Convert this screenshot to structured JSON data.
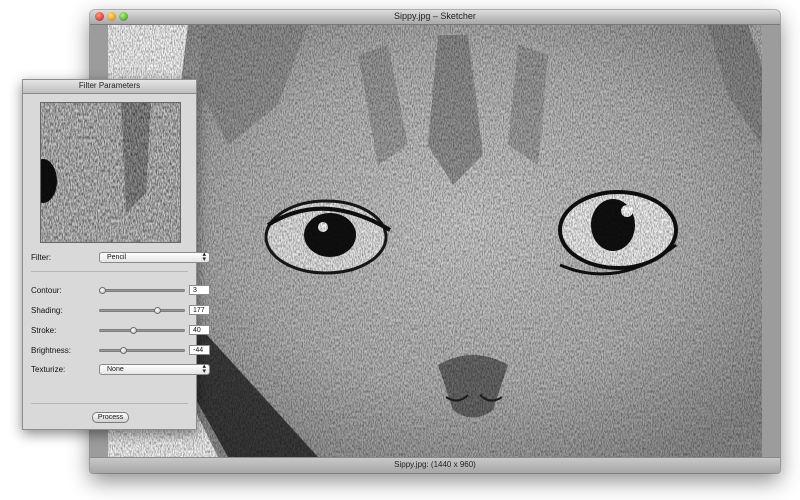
{
  "window": {
    "title": "Sippy.jpg – Sketcher",
    "status": "Sippy.jpg: (1440 x 960)"
  },
  "panel": {
    "title": "Filter Parameters",
    "filter": {
      "label": "Filter:",
      "value": "Pencil"
    },
    "sliders": [
      {
        "label": "Contour:",
        "value": "3",
        "fraction": 0.03
      },
      {
        "label": "Shading:",
        "value": "177",
        "fraction": 0.69
      },
      {
        "label": "Stroke:",
        "value": "40",
        "fraction": 0.4
      },
      {
        "label": "Brightness:",
        "value": "-44",
        "fraction": 0.28
      }
    ],
    "texturize": {
      "label": "Texturize:",
      "value": "None"
    },
    "process_label": "Process"
  },
  "icons": {
    "close": "close-icon",
    "minimize": "minimize-icon",
    "zoom": "zoom-icon",
    "popup_arrows": "up-down-arrows-icon"
  },
  "colors": {
    "window_gray": "#a9a9a9",
    "panel_gray": "#d9d9d9"
  }
}
